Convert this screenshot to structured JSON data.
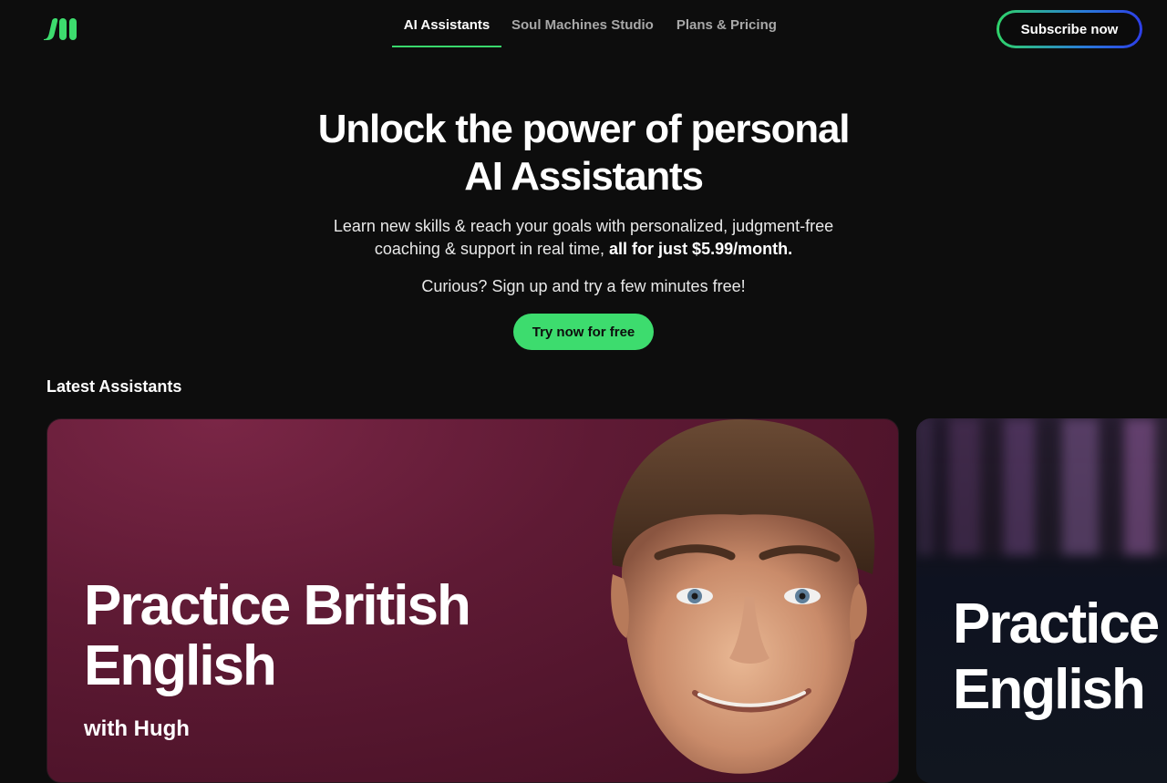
{
  "header": {
    "logo_alt": "Soul Machines logo",
    "nav": [
      {
        "label": "AI Assistants",
        "active": true
      },
      {
        "label": "Soul Machines Studio",
        "active": false
      },
      {
        "label": "Plans & Pricing",
        "active": false
      }
    ],
    "subscribe_label": "Subscribe now"
  },
  "hero": {
    "title_line1": "Unlock the power of personal",
    "title_line2": "AI Assistants",
    "subtitle_plain": "Learn new skills & reach your goals with personalized, judgment-free coaching & support in real time,",
    "subtitle_bold": "all for just $5.99/month.",
    "curious": "Curious? Sign up and try a few minutes free!",
    "cta_label": "Try now for free"
  },
  "latest": {
    "heading": "Latest Assistants",
    "cards": [
      {
        "title_line1": "Practice British",
        "title_line2": "English",
        "with": "with Hugh"
      },
      {
        "title_line1": "Practice",
        "title_line2": "English"
      }
    ]
  },
  "colors": {
    "background": "#0d0d0d",
    "accent_green": "#3ddc6e",
    "card_bg": "#5e1a34"
  }
}
